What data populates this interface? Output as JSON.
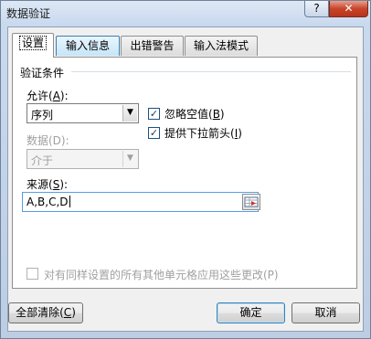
{
  "window": {
    "title": "数据验证",
    "help_label": "?",
    "close_label": "✕"
  },
  "tabs": [
    {
      "label": "设置",
      "active": true
    },
    {
      "label": "输入信息",
      "active": false
    },
    {
      "label": "出错警告",
      "active": false
    },
    {
      "label": "输入法模式",
      "active": false
    }
  ],
  "settings": {
    "section_title": "验证条件",
    "allow": {
      "label_pre": "允许(",
      "hotkey": "A",
      "label_post": "):",
      "value": "序列"
    },
    "ignore_blank": {
      "label_pre": "忽略空值(",
      "hotkey": "B",
      "label_post": ")",
      "checked": true
    },
    "in_cell_dropdown": {
      "label_pre": "提供下拉箭头(",
      "hotkey": "I",
      "label_post": ")",
      "checked": true
    },
    "data": {
      "label": "数据(D):",
      "value": "介于",
      "disabled": true
    },
    "source": {
      "label_pre": "来源(",
      "hotkey": "S",
      "label_post": "):",
      "value": "A,B,C,D"
    },
    "apply_all": {
      "label": "对有同样设置的所有其他单元格应用这些更改(P)",
      "checked": false,
      "disabled": true
    }
  },
  "buttons": {
    "clear_all": {
      "label_pre": "全部清除(",
      "hotkey": "C",
      "label_post": ")"
    },
    "ok": "确定",
    "cancel": "取消"
  },
  "colors": {
    "focus_border": "#569de5",
    "close_button": "#c7452b",
    "disabled_text": "#a0a0a0"
  }
}
